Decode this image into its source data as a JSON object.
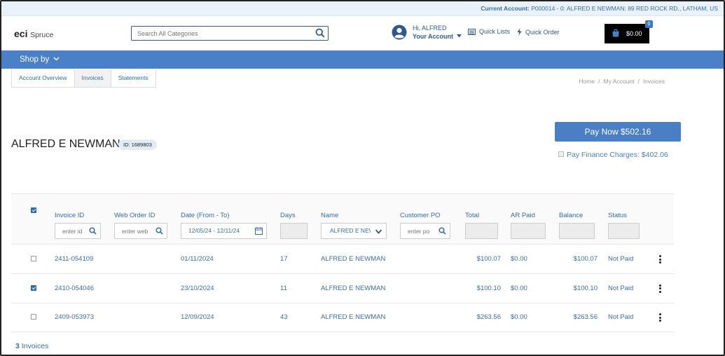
{
  "topbar": {
    "label": "Current Account:",
    "value": "P000014 - 0: ALFRED E NEWMAN: 89 RED ROCK RD., LATHAM, US"
  },
  "header": {
    "logo_brand": "eci",
    "logo_product": "Spruce",
    "search_placeholder": "Search All Categories",
    "greeting": "Hi, ALFRED",
    "your_account": "Your Account",
    "quick_lists": "Quick Lists",
    "quick_order": "Quick Order",
    "cart_total": "$0.00",
    "cart_count": "0"
  },
  "nav": {
    "shop_by": "Shop by"
  },
  "tabs": [
    "Account Overview",
    "Invoices",
    "Statements"
  ],
  "breadcrumb": [
    "Home",
    "My Account",
    "Invoices"
  ],
  "customer": {
    "name": "ALFRED E NEWMAN",
    "id_label": "ID: 1689803"
  },
  "pay": {
    "button": "Pay Now $502.16",
    "finance": "Pay Finance Charges: $402.06"
  },
  "table": {
    "columns": [
      "Invoice ID",
      "Web Order ID",
      "Date (From - To)",
      "Days",
      "Name",
      "Customer PO",
      "Total",
      "AR Paid",
      "Balance",
      "Status"
    ],
    "filters": {
      "invoice_placeholder": "enter id",
      "web_placeholder": "enter web",
      "date_range": "12/05/24 - 12/11/24",
      "name_value": "ALFRED E NEWMAN",
      "po_placeholder": "enter po"
    },
    "header_checked": true,
    "rows": [
      {
        "checked": false,
        "invoice": "2411-054109",
        "web": "",
        "date": "01/11/2024",
        "days": "17",
        "name": "ALFRED E NEWMAN",
        "po": "",
        "total": "$100.07",
        "ar": "$0.00",
        "balance": "$100.07",
        "status": "Not Paid"
      },
      {
        "checked": true,
        "invoice": "2410-054046",
        "web": "",
        "date": "23/10/2024",
        "days": "11",
        "name": "ALFRED E NEWMAN",
        "po": "",
        "total": "$100.10",
        "ar": "$0.00",
        "balance": "$100.10",
        "status": "Not Paid"
      },
      {
        "checked": false,
        "invoice": "2409-053973",
        "web": "",
        "date": "12/09/2024",
        "days": "43",
        "name": "ALFRED E NEWMAN",
        "po": "",
        "total": "$263.56",
        "ar": "$0.00",
        "balance": "$263.56",
        "status": "Not Paid"
      }
    ]
  },
  "footer": {
    "count": "3",
    "label": "Invoices"
  },
  "colors": {
    "primary": "#4a80c8",
    "link": "#2f6db0",
    "topbar": "#e9f2fa"
  },
  "icons": [
    "search-icon",
    "user-avatar-icon",
    "chevron-down-icon",
    "list-icon",
    "bolt-icon",
    "bag-icon",
    "calendar-icon",
    "kebab-menu-icon"
  ]
}
